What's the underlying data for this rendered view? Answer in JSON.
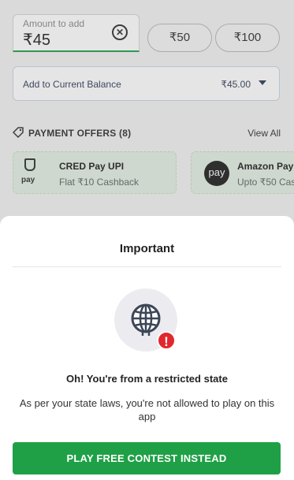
{
  "amount": {
    "label": "Amount to add",
    "value": "₹45",
    "clear_symbol": "✕"
  },
  "quick_amounts": [
    "₹50",
    "₹100"
  ],
  "balance": {
    "label": "Add to Current Balance",
    "value": "₹45.00"
  },
  "offers": {
    "title": "PAYMENT OFFERS (8)",
    "view_all": "View All",
    "items": [
      {
        "name": "CRED Pay UPI",
        "desc": "Flat ₹10 Cashback",
        "logo_text": "pay"
      },
      {
        "name": "Amazon Pay",
        "desc": "Upto ₹50 Cas",
        "logo_text": "pay"
      }
    ]
  },
  "sheet": {
    "title": "Important",
    "alert_symbol": "!",
    "message_title": "Oh! You're from a restricted state",
    "message_body": "As per your state laws, you're not allowed to play on this app",
    "cta_label": "PLAY FREE CONTEST INSTEAD"
  },
  "colors": {
    "primary_green": "#1fa046",
    "alert_red": "#e0282e",
    "balance_text": "#33405c"
  },
  "icons": [
    "clear-icon",
    "caret-down-icon",
    "tag-icon",
    "cred-logo-icon",
    "amazon-pay-logo-icon",
    "globe-icon",
    "alert-icon"
  ]
}
